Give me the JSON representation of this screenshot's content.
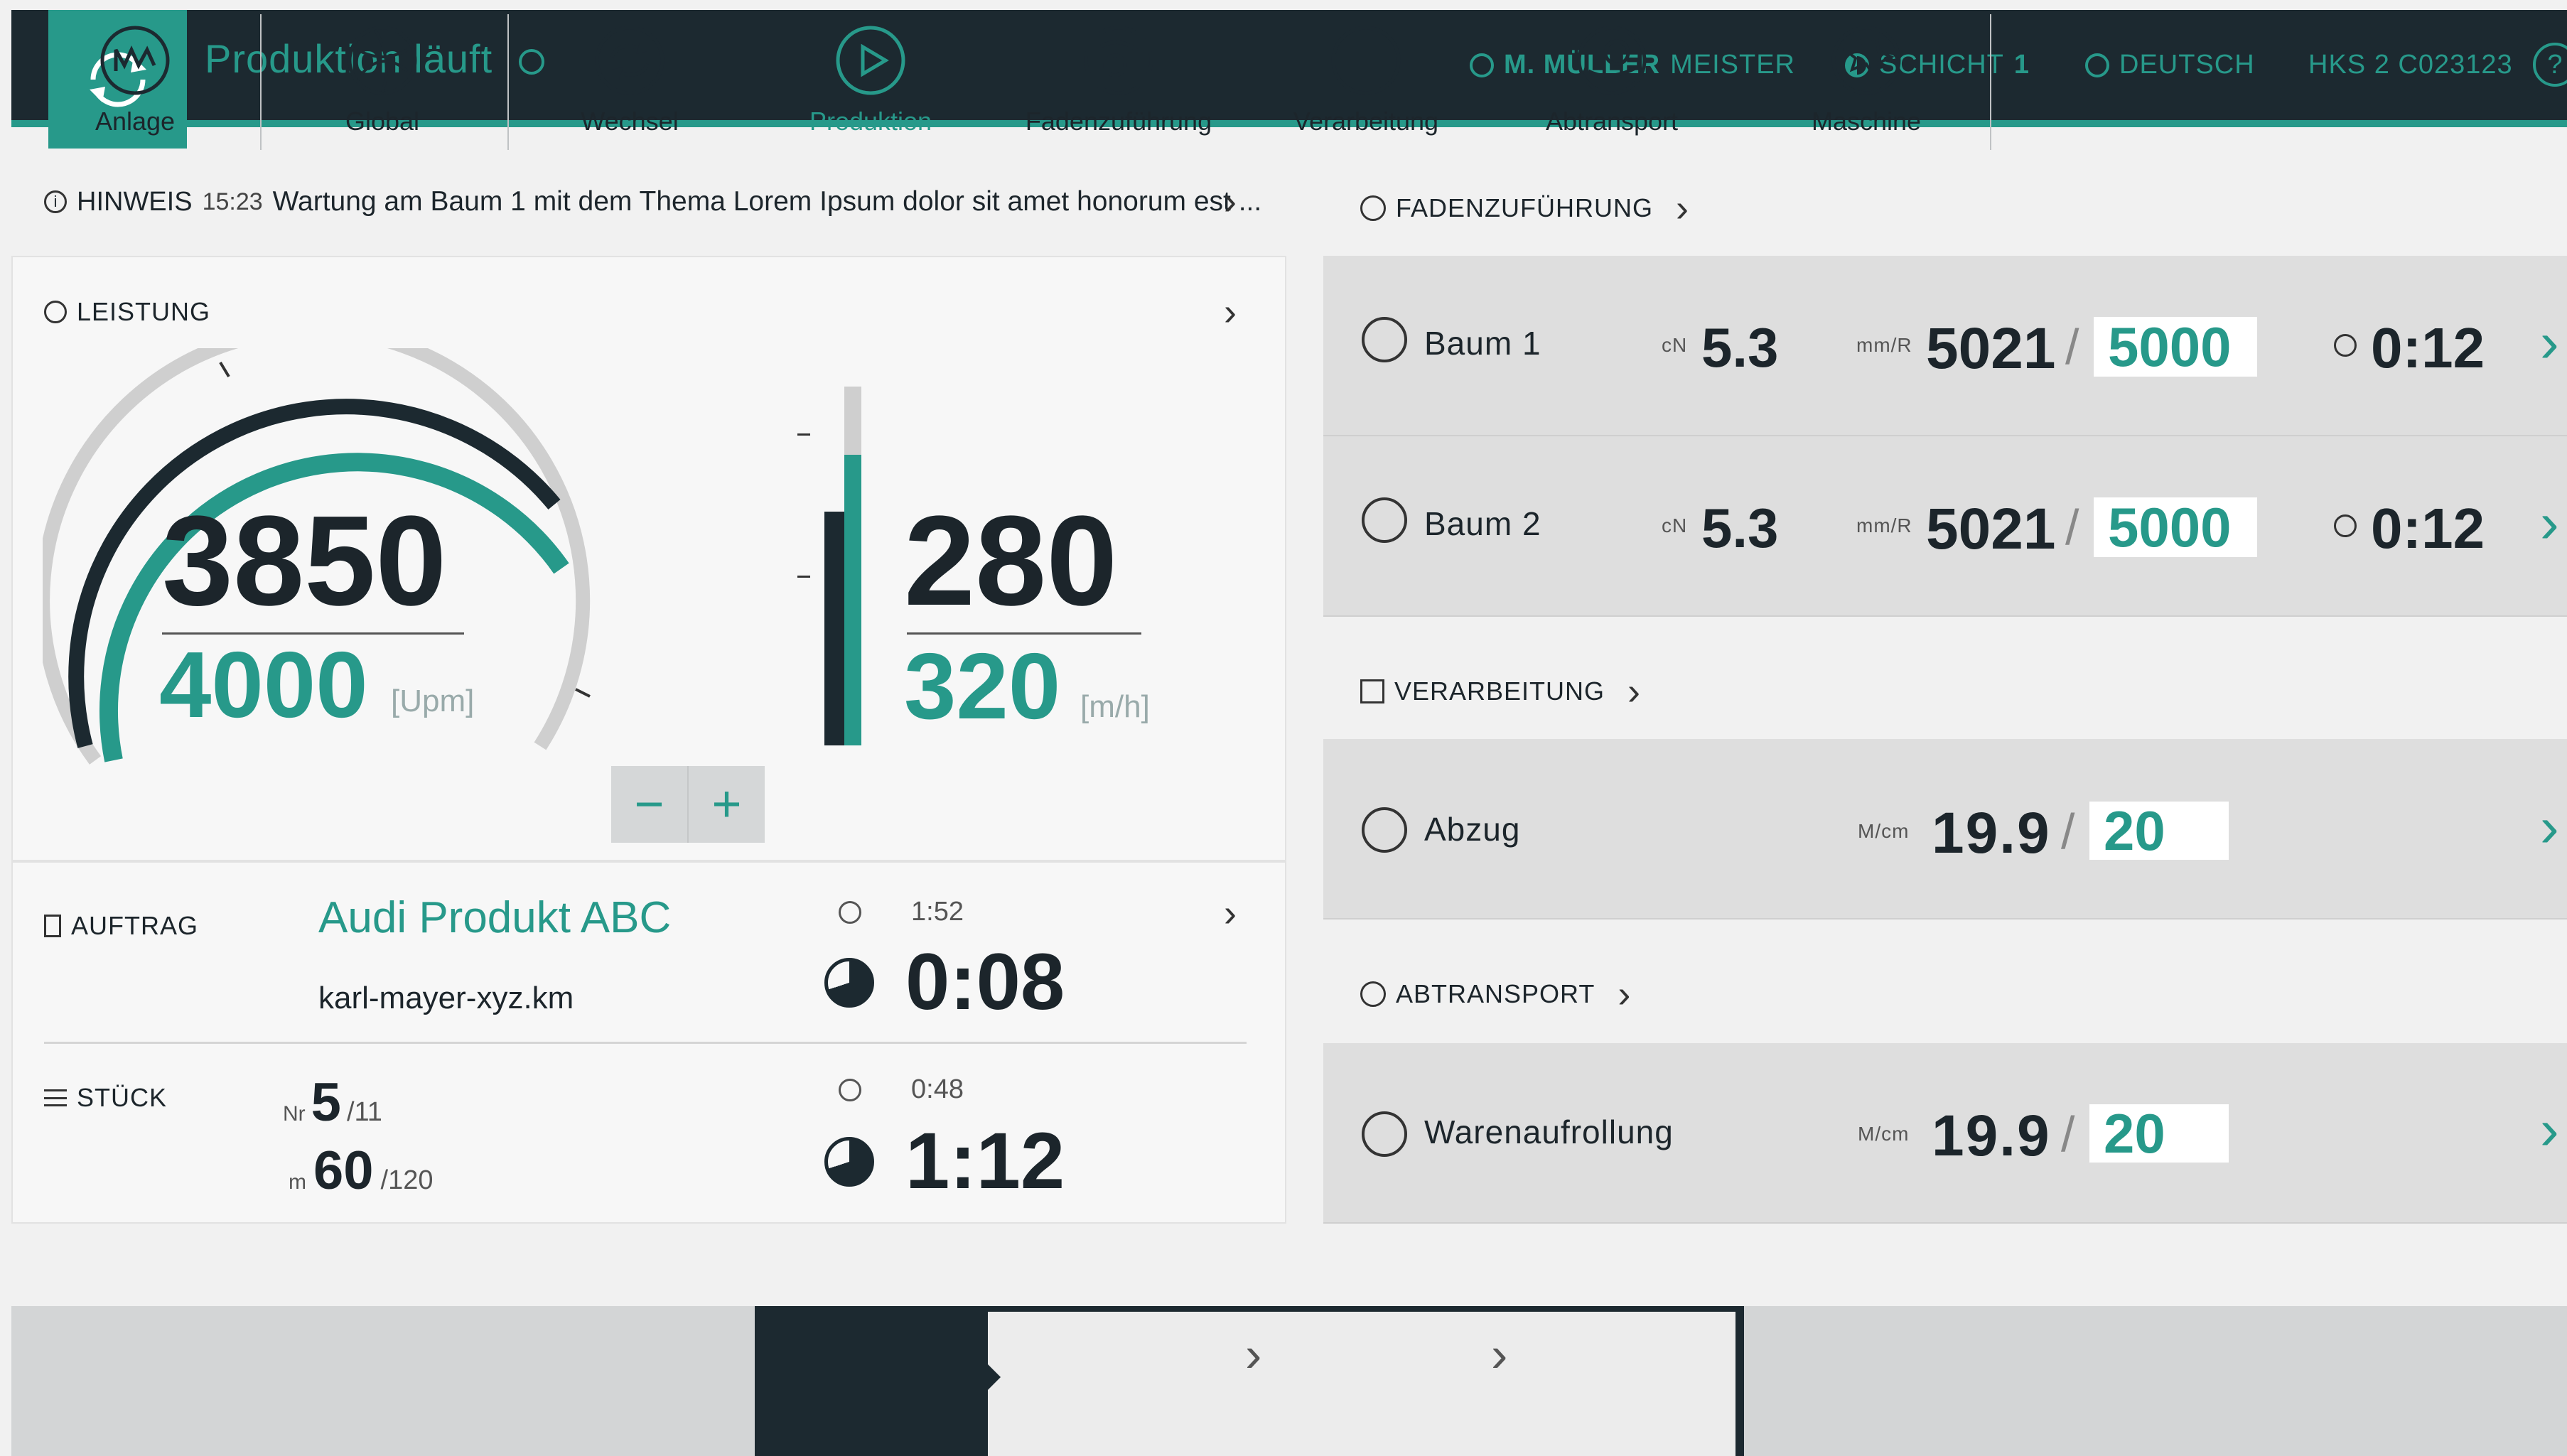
{
  "header": {
    "status": "Produktion läuft",
    "user_name": "M. MÜLLER",
    "user_role": "MEISTER",
    "shift_label": "SCHICHT",
    "shift_value": "1",
    "language": "DEUTSCH",
    "machine_id": "HKS 2 C023123",
    "help": "?",
    "accent_color": "#27998a",
    "bar_color": "#1c2930"
  },
  "notice": {
    "label": "HINWEIS",
    "time": "15:23",
    "text": "Wartung am  Baum 1 mit dem Thema Lorem Ipsum dolor sit amet honorum est ..."
  },
  "leistung": {
    "label": "LEISTUNG",
    "speed_actual": "3850",
    "speed_target": "4000",
    "speed_unit": "[Upm]",
    "speed_fraction": 0.8,
    "rate_actual": "280",
    "rate_target": "320",
    "rate_unit": "[m/h]",
    "rate_fraction": 0.8,
    "minus": "−",
    "plus": "+"
  },
  "auftrag": {
    "label": "AUFTRAG",
    "product": "Audi Produkt ABC",
    "file": "karl-mayer-xyz.km",
    "time_small": "1:52",
    "time_big": "0:08"
  },
  "stueck": {
    "label": "STÜCK",
    "nr_prefix": "Nr",
    "nr_value": "5",
    "nr_total": "/11",
    "m_prefix": "m",
    "m_value": "60",
    "m_total": "/120",
    "time_small": "0:48",
    "time_big": "1:12"
  },
  "fadenzufuehrung": {
    "label": "FADENZUFÜHRUNG",
    "items": [
      {
        "name": "Baum 1",
        "cn_unit": "cN",
        "cn_value": "5.3",
        "mm_unit": "mm/R",
        "actual": "5021",
        "slash": "/",
        "target": "5000",
        "time": "0:12"
      },
      {
        "name": "Baum 2",
        "cn_unit": "cN",
        "cn_value": "5.3",
        "mm_unit": "mm/R",
        "actual": "5021",
        "slash": "/",
        "target": "5000",
        "time": "0:12"
      }
    ]
  },
  "verarbeitung": {
    "label": "VERARBEITUNG",
    "item": {
      "name": "Abzug",
      "unit": "M/cm",
      "actual": "19.9",
      "slash": "/",
      "target": "20"
    }
  },
  "abtransport": {
    "label": "ABTRANSPORT",
    "item": {
      "name": "Warenaufrollung",
      "unit": "M/cm",
      "actual": "19.9",
      "slash": "/",
      "target": "20"
    }
  },
  "nav": {
    "items": [
      {
        "label": "Anlage",
        "icon": "anlage-icon"
      },
      {
        "label": "Global",
        "icon": "global-icon"
      },
      {
        "label": "Wechsel",
        "icon": "wechsel-icon"
      },
      {
        "label": "Produktion",
        "icon": "produktion-icon"
      },
      {
        "label": "Fadenzuführung",
        "icon": "fadenzufuehrung-icon"
      },
      {
        "label": "Verarbeitung",
        "icon": "verarbeitung-icon"
      },
      {
        "label": "Abtransport",
        "icon": "abtransport-icon"
      },
      {
        "label": "Maschine",
        "icon": "maschine-icon"
      }
    ]
  }
}
